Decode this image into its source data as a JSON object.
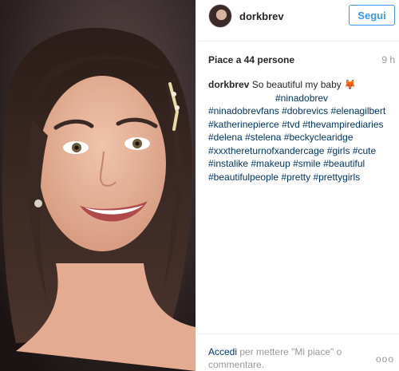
{
  "post": {
    "username": "dorkbrev",
    "follow_label": "Segui",
    "likes_text": "Piace a 44 persone",
    "time": "9 h",
    "caption_author": "dorkbrev",
    "caption_text": "So beautiful my baby 🦊",
    "hashtags": [
      "#ninadobrev",
      "#ninadobrevfans",
      "#dobrevics",
      "#elenagilbert",
      "#katherinepierce",
      "#tvd",
      "#thevampirediaries",
      "#delena",
      "#stelena",
      "#beckyclearidge",
      "#xxxthereturnofxandercage",
      "#girls",
      "#cute",
      "#instalike",
      "#makeup",
      "#smile",
      "#beautiful",
      "#beautifulpeople",
      "#pretty",
      "#prettygirls"
    ]
  },
  "footer": {
    "login_label": "Accedi",
    "prompt_text": "per mettere \"Mi piace\" o commentare.",
    "more_label": "ooo"
  }
}
